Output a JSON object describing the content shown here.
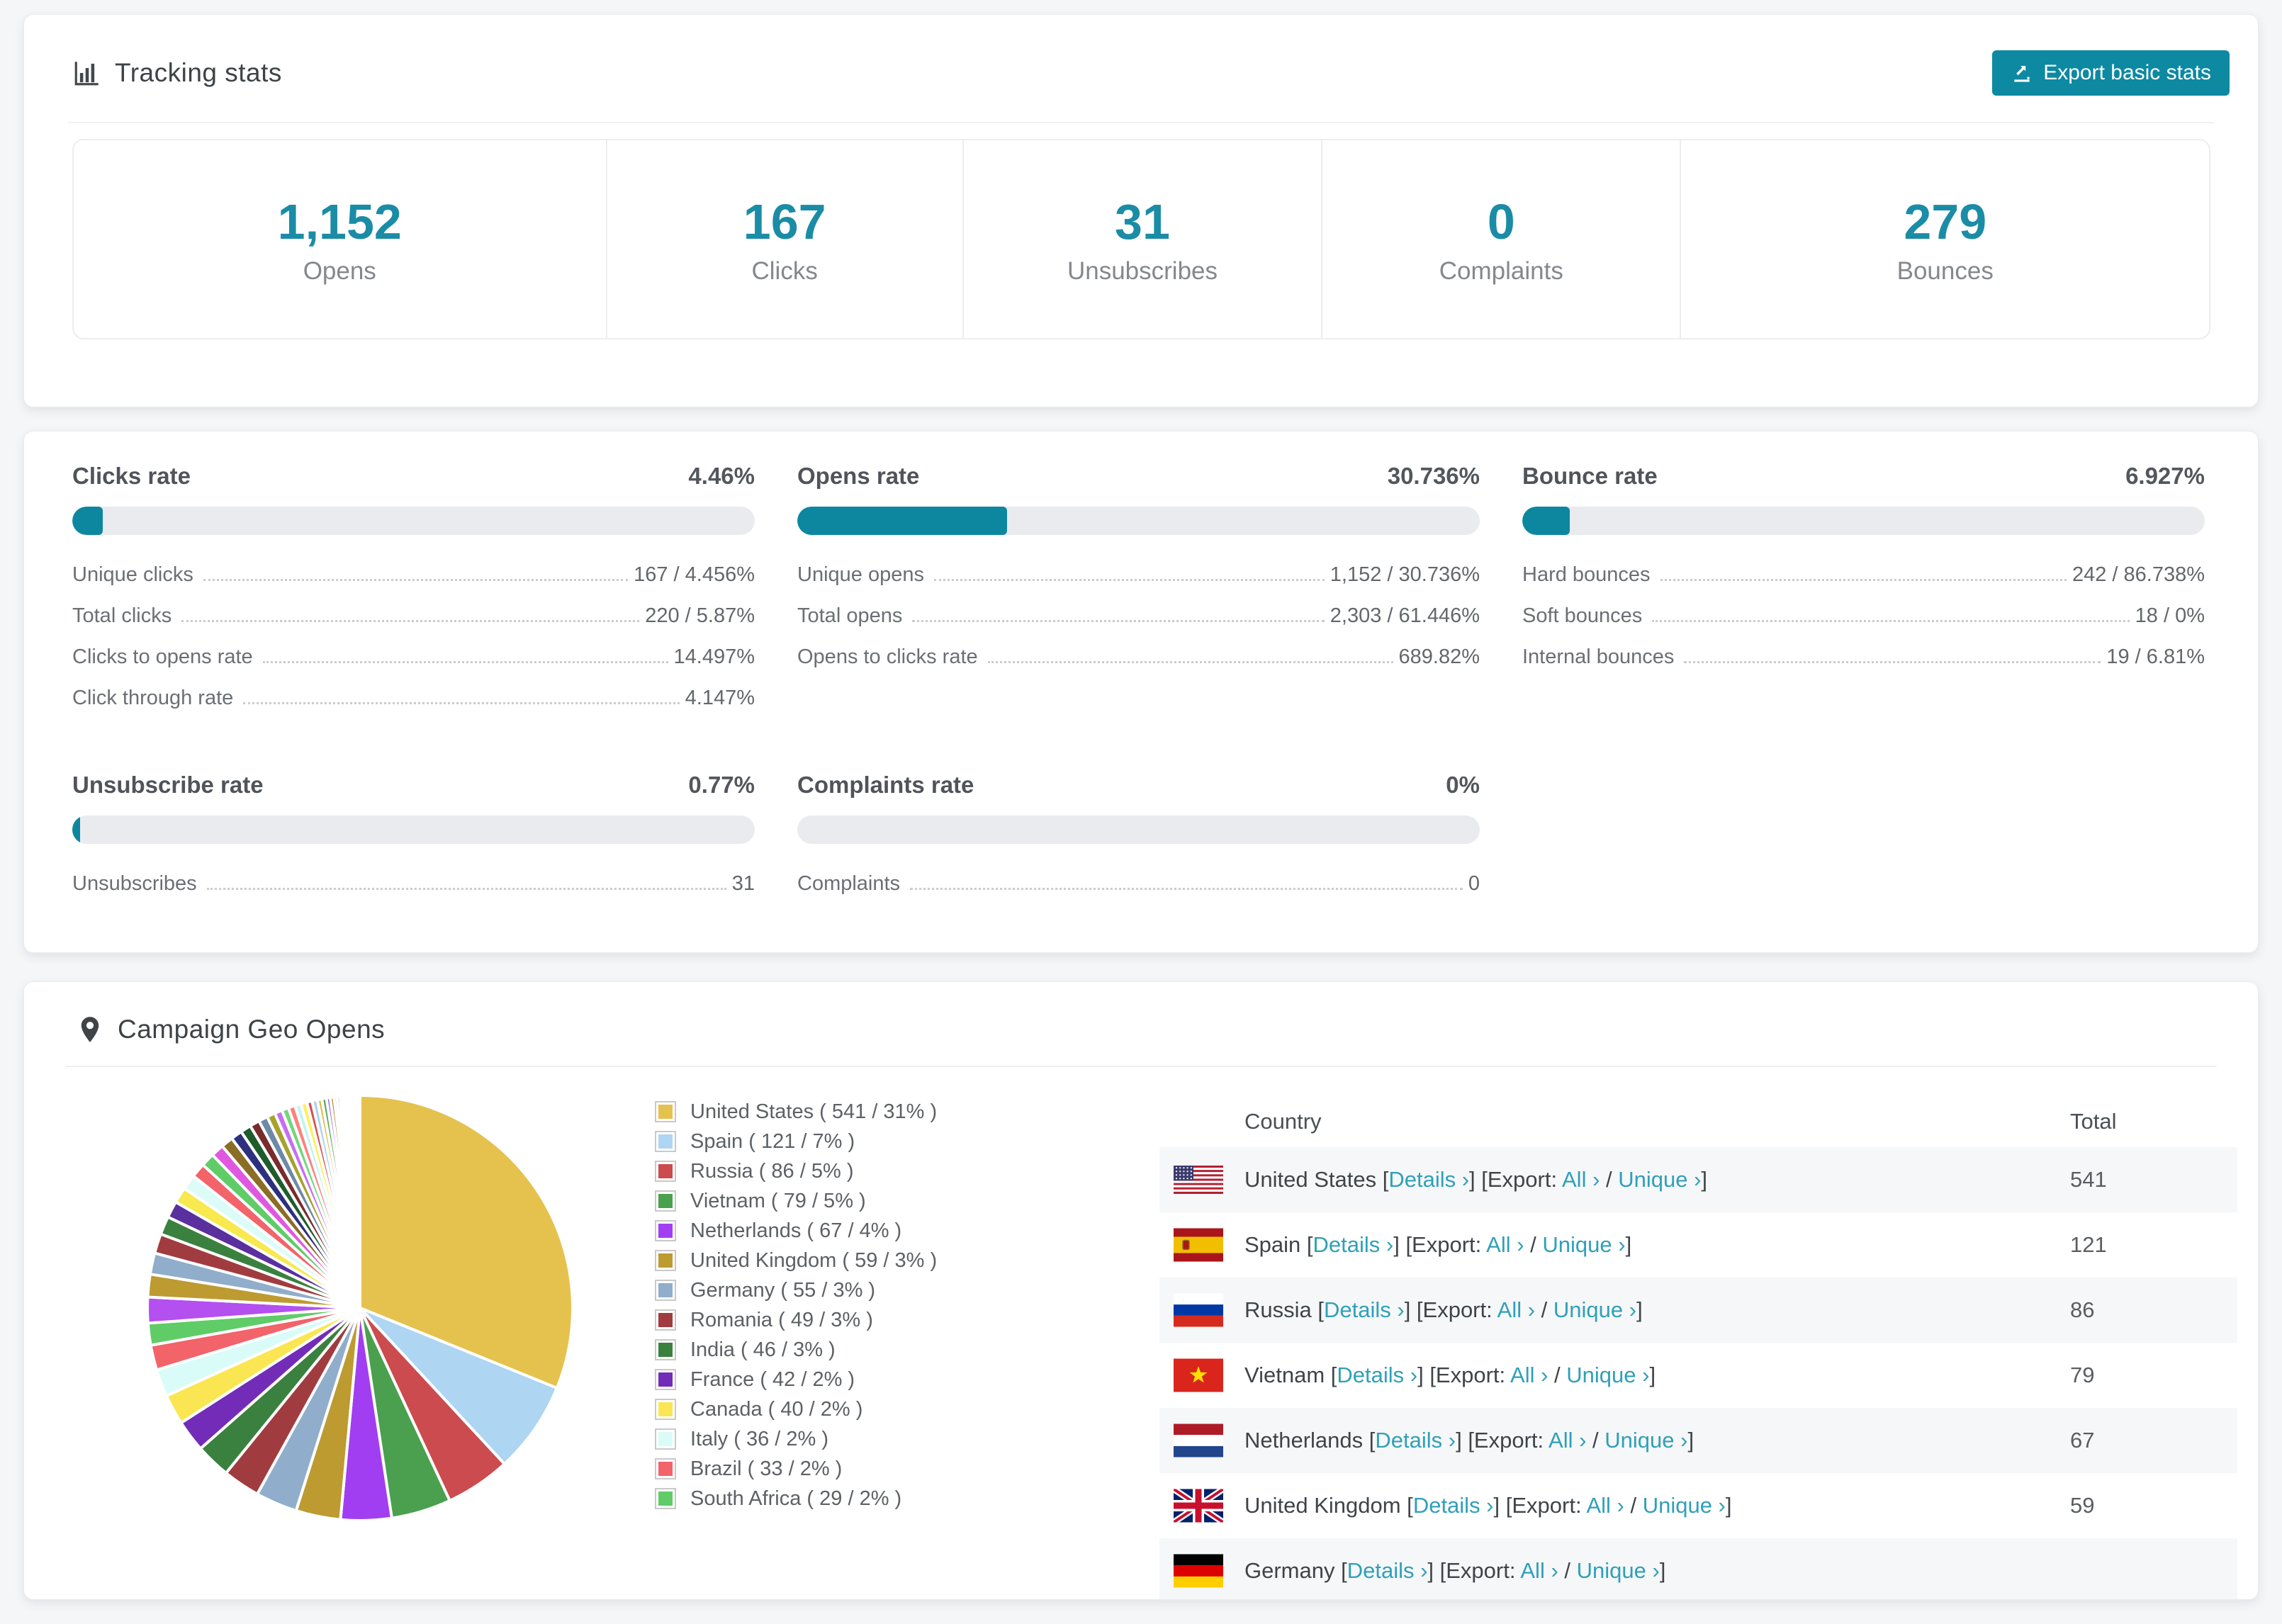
{
  "tracking": {
    "title": "Tracking stats",
    "export_label": "Export basic stats",
    "summary": [
      {
        "value": "1,152",
        "label": "Opens"
      },
      {
        "value": "167",
        "label": "Clicks"
      },
      {
        "value": "31",
        "label": "Unsubscribes"
      },
      {
        "value": "0",
        "label": "Complaints"
      },
      {
        "value": "279",
        "label": "Bounces"
      }
    ]
  },
  "rates": [
    {
      "title": "Clicks rate",
      "value": "4.46%",
      "percent": 4.46,
      "rows": [
        {
          "label": "Unique clicks",
          "value": "167 / 4.456%"
        },
        {
          "label": "Total clicks",
          "value": "220 / 5.87%"
        },
        {
          "label": "Clicks to opens rate",
          "value": "14.497%"
        },
        {
          "label": "Click through rate",
          "value": "4.147%"
        }
      ]
    },
    {
      "title": "Opens rate",
      "value": "30.736%",
      "percent": 30.736,
      "rows": [
        {
          "label": "Unique opens",
          "value": "1,152 / 30.736%"
        },
        {
          "label": "Total opens",
          "value": "2,303 / 61.446%"
        },
        {
          "label": "Opens to clicks rate",
          "value": "689.82%"
        }
      ]
    },
    {
      "title": "Bounce rate",
      "value": "6.927%",
      "percent": 6.927,
      "rows": [
        {
          "label": "Hard bounces",
          "value": "242 / 86.738%"
        },
        {
          "label": "Soft bounces",
          "value": "18 / 0%"
        },
        {
          "label": "Internal bounces",
          "value": "19 / 6.81%"
        }
      ]
    },
    {
      "title": "Unsubscribe rate",
      "value": "0.77%",
      "percent": 0.77,
      "rows": [
        {
          "label": "Unsubscribes",
          "value": "31"
        }
      ]
    },
    {
      "title": "Complaints rate",
      "value": "0%",
      "percent": 0,
      "rows": [
        {
          "label": "Complaints",
          "value": "0"
        }
      ]
    }
  ],
  "geo": {
    "title": "Campaign Geo Opens",
    "table": {
      "headers": [
        "Country",
        "Total"
      ],
      "link_details": "Details ›",
      "export_prefix": "Export:",
      "link_all": "All ›",
      "link_unique": "Unique ›",
      "rows": [
        {
          "country": "United States",
          "flag": "us",
          "total": "541"
        },
        {
          "country": "Spain",
          "flag": "es",
          "total": "121"
        },
        {
          "country": "Russia",
          "flag": "ru",
          "total": "86"
        },
        {
          "country": "Vietnam",
          "flag": "vn",
          "total": "79"
        },
        {
          "country": "Netherlands",
          "flag": "nl",
          "total": "67"
        },
        {
          "country": "United Kingdom",
          "flag": "gb",
          "total": "59"
        },
        {
          "country": "Germany",
          "flag": "de",
          "total": ""
        }
      ]
    }
  },
  "chart_data": {
    "type": "pie",
    "title": "Campaign Geo Opens",
    "legend_position": "right",
    "start_angle": "top",
    "direction": "clockwise",
    "series": [
      {
        "name": "United States",
        "value": 541,
        "pct": "31%",
        "color": "#e5c14e",
        "legend": "United States ( 541 / 31% )"
      },
      {
        "name": "Spain",
        "value": 121,
        "pct": "7%",
        "color": "#aed5f2",
        "legend": "Spain ( 121 / 7% )"
      },
      {
        "name": "Russia",
        "value": 86,
        "pct": "5%",
        "color": "#cb4b4e",
        "legend": "Russia ( 86 / 5% )"
      },
      {
        "name": "Vietnam",
        "value": 79,
        "pct": "5%",
        "color": "#4aa04e",
        "legend": "Vietnam ( 79 / 5% )"
      },
      {
        "name": "Netherlands",
        "value": 67,
        "pct": "4%",
        "color": "#a13ef2",
        "legend": "Netherlands ( 67 / 4% )"
      },
      {
        "name": "United Kingdom",
        "value": 59,
        "pct": "3%",
        "color": "#bd9b31",
        "legend": "United Kingdom ( 59 / 3% )"
      },
      {
        "name": "Germany",
        "value": 55,
        "pct": "3%",
        "color": "#90aecb",
        "legend": "Germany ( 55 / 3% )"
      },
      {
        "name": "Romania",
        "value": 49,
        "pct": "3%",
        "color": "#a03c40",
        "legend": "Romania ( 49 / 3% )"
      },
      {
        "name": "India",
        "value": 46,
        "pct": "3%",
        "color": "#3a813f",
        "legend": "India ( 46 / 3% )"
      },
      {
        "name": "France",
        "value": 42,
        "pct": "2%",
        "color": "#722cb8",
        "legend": "France ( 42 / 2% )"
      },
      {
        "name": "Canada",
        "value": 40,
        "pct": "2%",
        "color": "#fae652",
        "legend": "Canada ( 40 / 2% )"
      },
      {
        "name": "Italy",
        "value": 36,
        "pct": "2%",
        "color": "#d9fcf8",
        "legend": "Italy ( 36 / 2% )"
      },
      {
        "name": "Brazil",
        "value": 33,
        "pct": "2%",
        "color": "#f2636a",
        "legend": "Brazil ( 33 / 2% )"
      },
      {
        "name": "South Africa",
        "value": 29,
        "pct": "2%",
        "color": "#5fcc68",
        "legend": "South Africa ( 29 / 2% )"
      }
    ],
    "others": {
      "values": [
        34,
        30,
        28,
        26,
        24,
        22,
        21,
        20,
        19,
        18,
        17,
        16,
        15,
        14,
        13,
        12,
        11,
        10,
        9,
        9,
        8,
        8,
        7,
        7,
        6,
        6,
        5,
        5,
        4,
        4,
        3,
        3,
        3,
        2,
        2,
        2,
        2,
        2,
        2,
        1,
        1,
        1,
        1,
        1
      ],
      "palette": [
        "#b44ff0",
        "#bd9b31",
        "#90aecb",
        "#a03c40",
        "#3a813f",
        "#5a2f9e",
        "#f7e94e",
        "#dcfcf8",
        "#f2636a",
        "#5fcc68",
        "#e058e0",
        "#8a6d26",
        "#2d2f7f",
        "#1e5c2c",
        "#7a2b2b",
        "#6d89a8",
        "#a7a22c",
        "#c66ff2",
        "#74d67c",
        "#ff8080",
        "#c2f5ef",
        "#fcf060",
        "#d85050",
        "#a8d4f0",
        "#e0bc48",
        "#58a858",
        "#9a55ee",
        "#b09030",
        "#88a8c8",
        "#983838",
        "#2e7834",
        "#5630a0",
        "#f0e060",
        "#d0f8f0",
        "#ee6868",
        "#68c870",
        "#d860d8",
        "#403880",
        "#886020",
        "#c05858",
        "#4a9d4a",
        "#7b3fc4",
        "#ffe680",
        "#9fd0ee"
      ]
    }
  },
  "colors": {
    "accent_teal": "#0d89a2",
    "stat_teal": "#1b8ca6",
    "link_teal": "#2fa0b8",
    "bar_track": "#e9ebee",
    "row_stripe": "#f6f7f8"
  }
}
